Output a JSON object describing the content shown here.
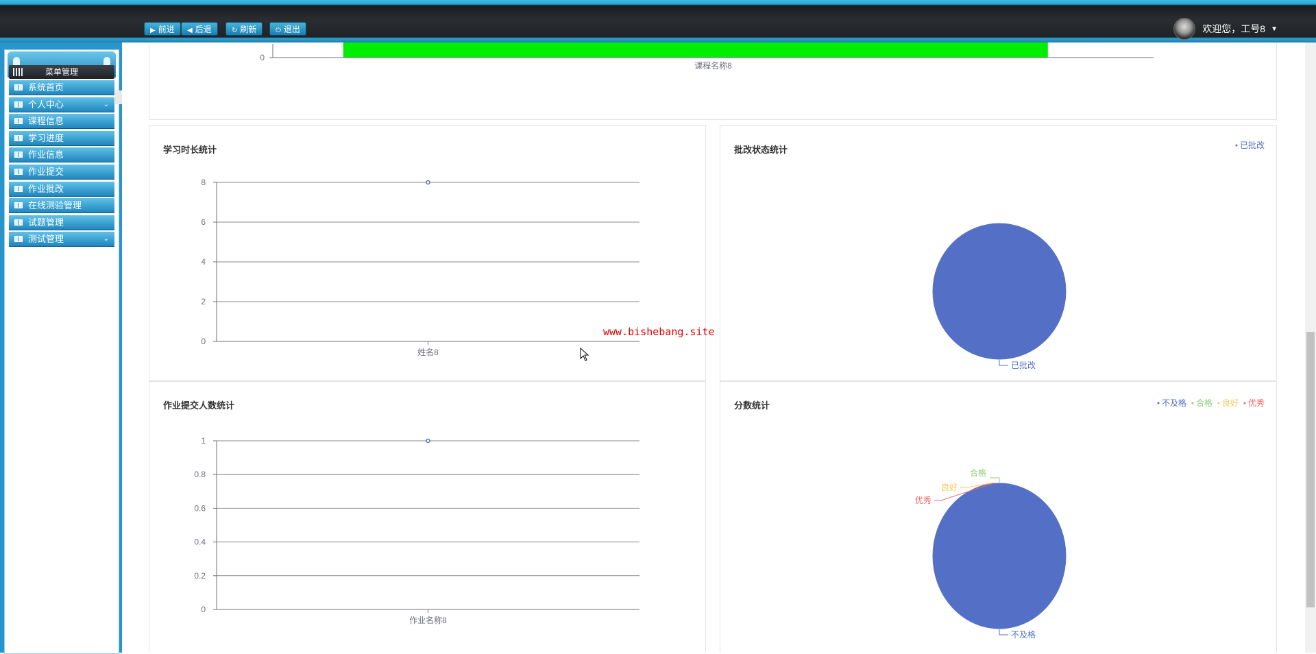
{
  "toolbar": {
    "forward_label": "前进",
    "back_label": "后退",
    "refresh_label": "刷新",
    "exit_label": "退出"
  },
  "user": {
    "greeting": "欢迎您，工号8"
  },
  "sidebar": {
    "title": "菜单管理",
    "items": [
      {
        "label": "系统首页",
        "expandable": false
      },
      {
        "label": "个人中心",
        "expandable": true
      },
      {
        "label": "课程信息",
        "expandable": false
      },
      {
        "label": "学习进度",
        "expandable": false
      },
      {
        "label": "作业信息",
        "expandable": false
      },
      {
        "label": "作业提交",
        "expandable": false
      },
      {
        "label": "作业批改",
        "expandable": false
      },
      {
        "label": "在线测验管理",
        "expandable": false
      },
      {
        "label": "试题管理",
        "expandable": false
      },
      {
        "label": "测试管理",
        "expandable": true
      }
    ]
  },
  "watermark": "www.bishebang.site",
  "chart_data": [
    {
      "id": "course-chart",
      "type": "bar",
      "categories": [
        "课程名称8"
      ],
      "values": [
        0
      ],
      "y_tick_labels": [
        "0"
      ],
      "color": "#00ee00"
    },
    {
      "id": "study-time-chart",
      "type": "line",
      "title": "学习时长统计",
      "categories": [
        "姓名8"
      ],
      "values": [
        8
      ],
      "ylim": [
        0,
        8
      ],
      "y_ticks": [
        "0",
        "2",
        "4",
        "6",
        "8"
      ],
      "grid": true,
      "color": "#5470c6"
    },
    {
      "id": "grading-status-chart",
      "type": "pie",
      "title": "批改状态统计",
      "legend": [
        "已批改"
      ],
      "legend_position": "top-right",
      "slices": [
        {
          "label": "已批改",
          "value": 1,
          "color": "#5470c6"
        }
      ]
    },
    {
      "id": "submission-count-chart",
      "type": "line",
      "title": "作业提交人数统计",
      "categories": [
        "作业名称8"
      ],
      "values": [
        1
      ],
      "ylim": [
        0,
        1
      ],
      "y_ticks": [
        "0",
        "0.2",
        "0.4",
        "0.6",
        "0.8",
        "1"
      ],
      "grid": true,
      "color": "#5470c6"
    },
    {
      "id": "score-chart",
      "type": "pie",
      "title": "分数统计",
      "legend": [
        "不及格",
        "合格",
        "良好",
        "优秀"
      ],
      "legend_position": "top-right",
      "slices": [
        {
          "label": "不及格",
          "value": 1,
          "color": "#5470c6"
        },
        {
          "label": "合格",
          "value": 0,
          "color": "#91cc75"
        },
        {
          "label": "良好",
          "value": 0,
          "color": "#fac858"
        },
        {
          "label": "优秀",
          "value": 0,
          "color": "#ee6666"
        }
      ]
    }
  ]
}
